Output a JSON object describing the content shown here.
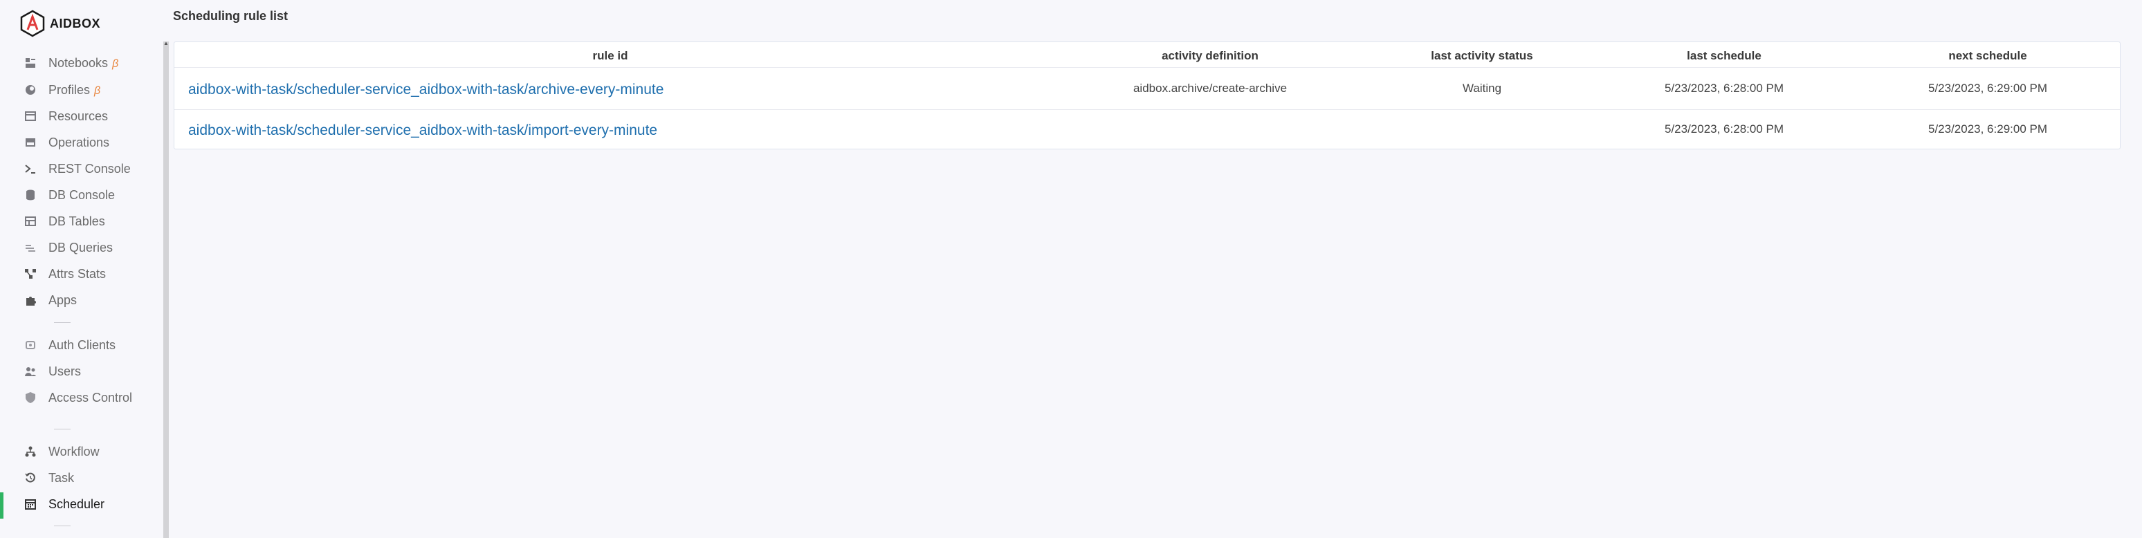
{
  "brand": {
    "name": "AIDBOX"
  },
  "sidebar": {
    "items": [
      {
        "label": "Notebooks",
        "icon": "notebook-icon",
        "beta": "β"
      },
      {
        "label": "Profiles",
        "icon": "profile-icon",
        "beta": "β"
      },
      {
        "label": "Resources",
        "icon": "resources-icon"
      },
      {
        "label": "Operations",
        "icon": "operations-icon"
      },
      {
        "label": "REST Console",
        "icon": "terminal-icon"
      },
      {
        "label": "DB Console",
        "icon": "database-icon"
      },
      {
        "label": "DB Tables",
        "icon": "table-icon"
      },
      {
        "label": "DB Queries",
        "icon": "queries-icon"
      },
      {
        "label": "Attrs Stats",
        "icon": "stats-icon"
      },
      {
        "label": "Apps",
        "icon": "puzzle-icon"
      },
      {
        "label": "Auth Clients",
        "icon": "auth-client-icon"
      },
      {
        "label": "Users",
        "icon": "users-icon"
      },
      {
        "label": "Access Control",
        "icon": "shield-icon"
      },
      {
        "label": "Workflow",
        "icon": "workflow-icon"
      },
      {
        "label": "Task",
        "icon": "history-icon"
      },
      {
        "label": "Scheduler",
        "icon": "calendar-icon",
        "active": true
      }
    ]
  },
  "main": {
    "title": "Scheduling rule list",
    "table": {
      "columns": [
        "rule id",
        "activity definition",
        "last activity status",
        "last schedule",
        "next schedule"
      ],
      "rows": [
        {
          "rule_id": "aidbox-with-task/scheduler-service_aidbox-with-task/archive-every-minute",
          "activity_definition": "aidbox.archive/create-archive",
          "last_activity_status": "Waiting",
          "last_schedule": "5/23/2023, 6:28:00 PM",
          "next_schedule": "5/23/2023, 6:29:00 PM"
        },
        {
          "rule_id": "aidbox-with-task/scheduler-service_aidbox-with-task/import-every-minute",
          "activity_definition": "",
          "last_activity_status": "",
          "last_schedule": "5/23/2023, 6:28:00 PM",
          "next_schedule": "5/23/2023, 6:29:00 PM"
        }
      ]
    }
  },
  "colors": {
    "accent": "#2fb462",
    "link": "#1f6fae",
    "beta": "#e8843c"
  }
}
